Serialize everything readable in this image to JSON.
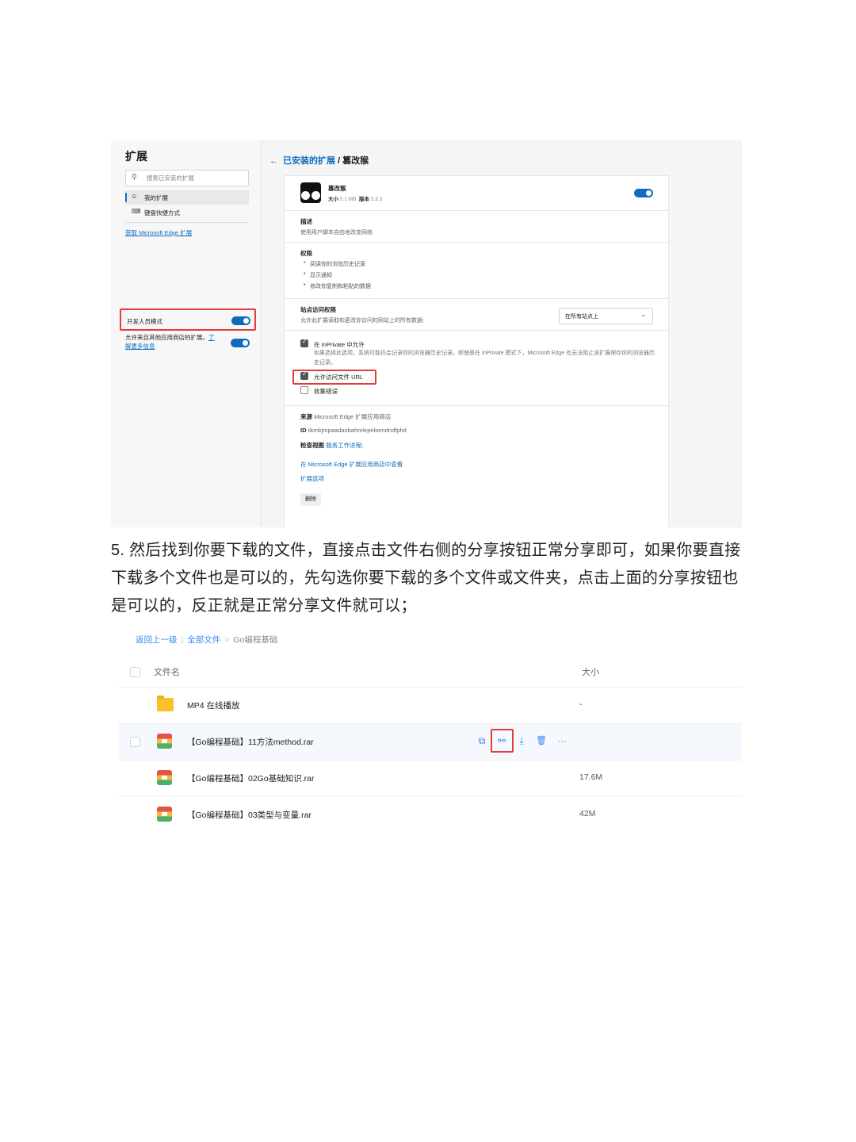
{
  "extensions_page": {
    "sidebar": {
      "title": "扩展",
      "search_placeholder": "搜索已安装的扩展",
      "items": [
        {
          "label": "我的扩展",
          "icon": "extension-icon",
          "active": true
        },
        {
          "label": "键盘快捷方式",
          "icon": "keyboard-icon",
          "active": false
        }
      ],
      "get_extensions_link": "获取 Microsoft Edge 扩展",
      "developer_mode_label": "开发人员模式",
      "developer_mode_on": true,
      "allow_other_stores_text": "允许来自其他应用商店的扩展。",
      "learn_more_link_a": "了",
      "learn_more_link_b": "解更多信息",
      "allow_other_stores_on": true
    },
    "main": {
      "back_arrow": "←",
      "breadcrumb_link": "已安装的扩展",
      "breadcrumb_sep": " / ",
      "breadcrumb_current": "篡改猴",
      "extension": {
        "name": "篡改猴",
        "size_label": "大小",
        "size_value": "5.1 MB",
        "version_label": "版本",
        "version_value": "5.3.3",
        "enabled": true
      },
      "description": {
        "title": "描述",
        "text": "使用用户脚本自由地改变网络"
      },
      "permissions": {
        "title": "权限",
        "items": [
          "阅读你的浏览历史记录",
          "显示通知",
          "修改你复制和粘贴的数据"
        ]
      },
      "site_access": {
        "title": "站点访问权限",
        "text": "允许此扩展读取和更改你访问的网站上的所有数据:",
        "dropdown_value": "在所有站点上"
      },
      "options": {
        "inprivate_label": "在 InPrivate 中允许",
        "inprivate_checked": true,
        "inprivate_desc": "如果选择此选项，系统可能仍会记录你的浏览器历史记录。即使是在 InPrivate 模式下，Microsoft Edge 也无法阻止该扩展保存你的浏览器历史记录。",
        "file_url_label": "允许访问文件 URL",
        "file_url_checked": true,
        "collect_errors_label": "收集错误",
        "collect_errors_checked": false
      },
      "details": {
        "source_label": "来源",
        "source_value": "Microsoft Edge 扩展应用商店",
        "id_label": "ID",
        "id_value": "iikmkjmpaadaobahmlepeloendndfphd",
        "inspect_label": "检查视图",
        "inspect_link": "服务工作进程;",
        "store_link": "在 Microsoft Edge 扩展应用商店中查看",
        "options_link": "扩展选项",
        "remove_button": "删除"
      }
    }
  },
  "paragraph": "5. 然后找到你要下载的文件，直接点击文件右侧的分享按钮正常分享即可，如果你要直接下载多个文件也是可以的，先勾选你要下载的多个文件或文件夹，点击上面的分享按钮也是可以的，反正就是正常分享文件就可以；",
  "file_list": {
    "breadcrumb": {
      "back": "返回上一级",
      "sep1": "|",
      "all_files": "全部文件",
      "sep2": ">",
      "current": "Go编程基础"
    },
    "header": {
      "name": "文件名",
      "size": "大小"
    },
    "rows": [
      {
        "name": "MP4 在线播放",
        "size": "-",
        "type": "folder"
      },
      {
        "name": "【Go编程基础】11方法method.rar",
        "size": "",
        "type": "rar",
        "hovered": true
      },
      {
        "name": "【Go编程基础】02Go基础知识.rar",
        "size": "17.6M",
        "type": "rar"
      },
      {
        "name": "【Go编程基础】03类型与变量.rar",
        "size": "42M",
        "type": "rar"
      }
    ],
    "row_actions": {
      "open_icon": "⧉",
      "share_icon": "⚯",
      "download_icon": "⤓",
      "delete_icon": "🗑",
      "more_icon": "···"
    }
  },
  "colors": {
    "edge_blue": "#0f6cbd",
    "highlight_red": "#e23c3c",
    "link_blue": "#3a86f7"
  }
}
